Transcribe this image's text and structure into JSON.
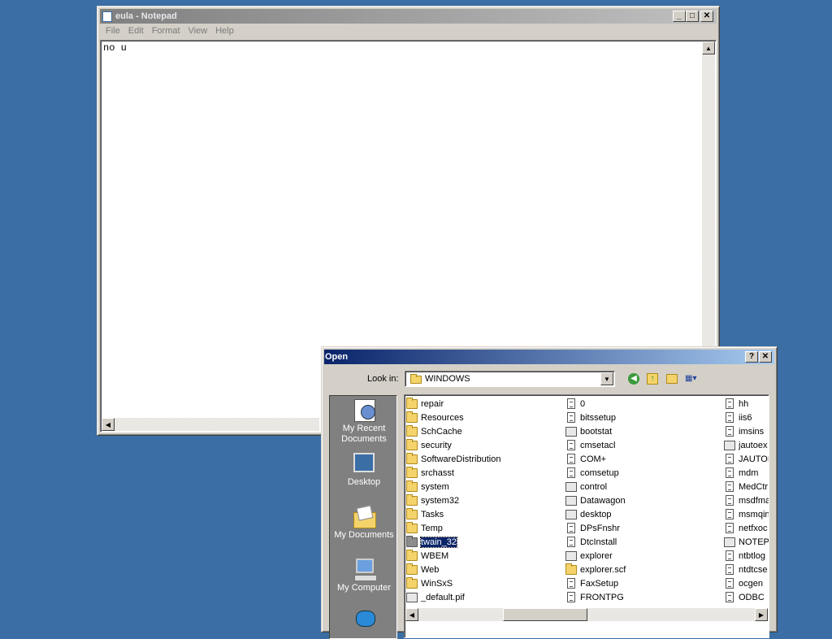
{
  "notepad": {
    "title": "eula - Notepad",
    "menu": [
      "File",
      "Edit",
      "Format",
      "View",
      "Help"
    ],
    "content": "no u",
    "minimize": "_",
    "maximize": "□",
    "close": "✕"
  },
  "open_dialog": {
    "title": "Open",
    "help_btn": "?",
    "close_btn": "✕",
    "look_in_label": "Look in:",
    "look_in_value": "WINDOWS",
    "places": [
      {
        "label": "My Recent Documents",
        "icon": "recent-documents-icon"
      },
      {
        "label": "Desktop",
        "icon": "desktop-icon"
      },
      {
        "label": "My Documents",
        "icon": "my-documents-icon"
      },
      {
        "label": "My Computer",
        "icon": "my-computer-icon"
      },
      {
        "label": "",
        "icon": "my-network-icon"
      }
    ],
    "columns": [
      [
        {
          "name": "repair",
          "type": "folder"
        },
        {
          "name": "Resources",
          "type": "folder"
        },
        {
          "name": "SchCache",
          "type": "folder"
        },
        {
          "name": "security",
          "type": "folder"
        },
        {
          "name": "SoftwareDistribution",
          "type": "folder"
        },
        {
          "name": "srchasst",
          "type": "folder"
        },
        {
          "name": "system",
          "type": "folder"
        },
        {
          "name": "system32",
          "type": "folder"
        },
        {
          "name": "Tasks",
          "type": "folder"
        },
        {
          "name": "Temp",
          "type": "folder"
        },
        {
          "name": "twain_32",
          "type": "folder-gray",
          "selected": true
        },
        {
          "name": "WBEM",
          "type": "folder"
        },
        {
          "name": "Web",
          "type": "folder"
        },
        {
          "name": "WinSxS",
          "type": "folder"
        },
        {
          "name": "_default.pif",
          "type": "app"
        }
      ],
      [
        {
          "name": "0",
          "type": "doc"
        },
        {
          "name": "bitssetup",
          "type": "doc"
        },
        {
          "name": "bootstat",
          "type": "app"
        },
        {
          "name": "cmsetacl",
          "type": "doc"
        },
        {
          "name": "COM+",
          "type": "doc"
        },
        {
          "name": "comsetup",
          "type": "doc"
        },
        {
          "name": "control",
          "type": "app"
        },
        {
          "name": "Datawagon",
          "type": "app"
        },
        {
          "name": "desktop",
          "type": "app"
        },
        {
          "name": "DPsFnshr",
          "type": "doc"
        },
        {
          "name": "DtcInstall",
          "type": "doc"
        },
        {
          "name": "explorer",
          "type": "app"
        },
        {
          "name": "explorer.scf",
          "type": "folder"
        },
        {
          "name": "FaxSetup",
          "type": "doc"
        },
        {
          "name": "FRONTPG",
          "type": "doc"
        }
      ],
      [
        {
          "name": "hh",
          "type": "doc"
        },
        {
          "name": "iis6",
          "type": "doc"
        },
        {
          "name": "imsins",
          "type": "doc"
        },
        {
          "name": "jautoex",
          "type": "app"
        },
        {
          "name": "JAUTOE",
          "type": "doc"
        },
        {
          "name": "mdm",
          "type": "doc"
        },
        {
          "name": "MedCtr",
          "type": "doc"
        },
        {
          "name": "msdfma",
          "type": "doc"
        },
        {
          "name": "msmqin",
          "type": "doc"
        },
        {
          "name": "netfxoc",
          "type": "doc"
        },
        {
          "name": "NOTEPA",
          "type": "app"
        },
        {
          "name": "ntbtlog",
          "type": "doc"
        },
        {
          "name": "ntdtcse",
          "type": "doc"
        },
        {
          "name": "ocgen",
          "type": "doc"
        },
        {
          "name": "ODBC",
          "type": "doc"
        }
      ]
    ]
  }
}
